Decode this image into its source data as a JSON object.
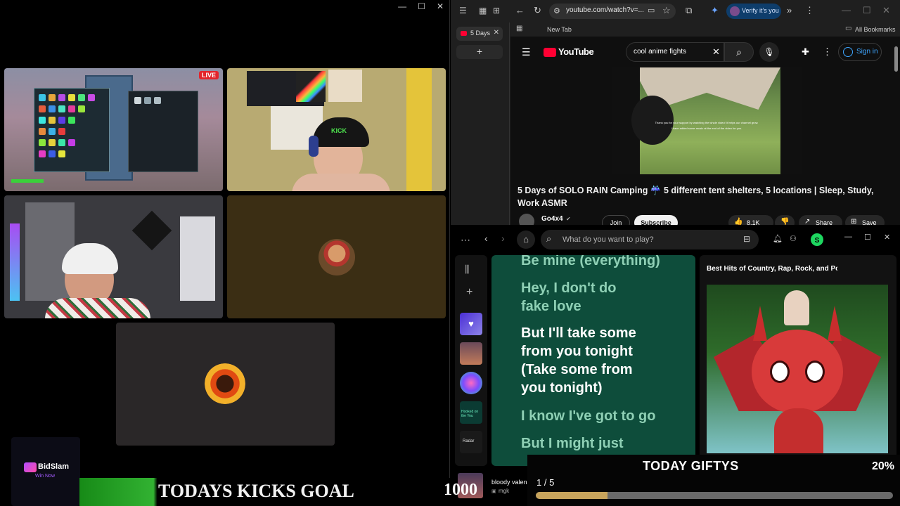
{
  "stream": {
    "window_controls": [
      "—",
      "☐",
      "✕"
    ],
    "live_badge": "LIVE",
    "cap_text": "KICK",
    "goal_text": "TODAYS KICKS GOAL",
    "goal_number": "1000",
    "sponsor_name": "BidSlam",
    "sponsor_tagline": "Win Now"
  },
  "browser": {
    "tab_title": "5 Days",
    "url": "youtube.com/watch?v=...",
    "verify_label": "Verify it's you",
    "bookmark_new_tab": "New Tab",
    "all_bookmarks": "All Bookmarks",
    "youtube": {
      "logo": "YouTube",
      "search_value": "cool anime fights",
      "sign_in": "Sign in",
      "video_title": "5 Days of SOLO RAIN Camping ☔ 5 different tent shelters, 5 locations | Sleep, Study, Work ASMR",
      "channel": "Go4x4",
      "join": "Join",
      "subscribe": "Subscribe",
      "likes": "8.1K",
      "share": "Share",
      "save": "Save",
      "video_overlay_1": "Thank you for your support by watching the whole video! It helps our channel grow.",
      "video_overlay_2": "I have added some music at the end of the video for you."
    }
  },
  "spotify": {
    "search_placeholder": "What do you want to play?",
    "avatar_letter": "S",
    "lyrics": [
      {
        "text": "Be mine (everything)",
        "active": false
      },
      {
        "text": "Hey, I don't do fake love",
        "active": false
      },
      {
        "text": "But I'll take some from you tonight (Take some from you tonight)",
        "active": true
      },
      {
        "text": "I know I've got to go",
        "active": false
      },
      {
        "text": "But I might just",
        "active": false
      }
    ],
    "playlist_title": "Best Hits of Country, Rap, Rock, and Pop",
    "now_playing_title": "bloody valentine",
    "now_playing_artist": "mgk",
    "lib_thumb_labels": [
      "Hooked on the You",
      "Radar"
    ]
  },
  "gifty": {
    "title": "TODAY GIFTYS",
    "count": "1 / 5",
    "percent": "20%",
    "progress": 0.2
  },
  "colors": {
    "lyrics_bg": "#0e4d3b",
    "lyrics_active": "#ffffff",
    "lyrics_inactive": "#8fd0b5",
    "goal_green": "#2fae2f",
    "gifty_bar": "#c8a45c"
  }
}
